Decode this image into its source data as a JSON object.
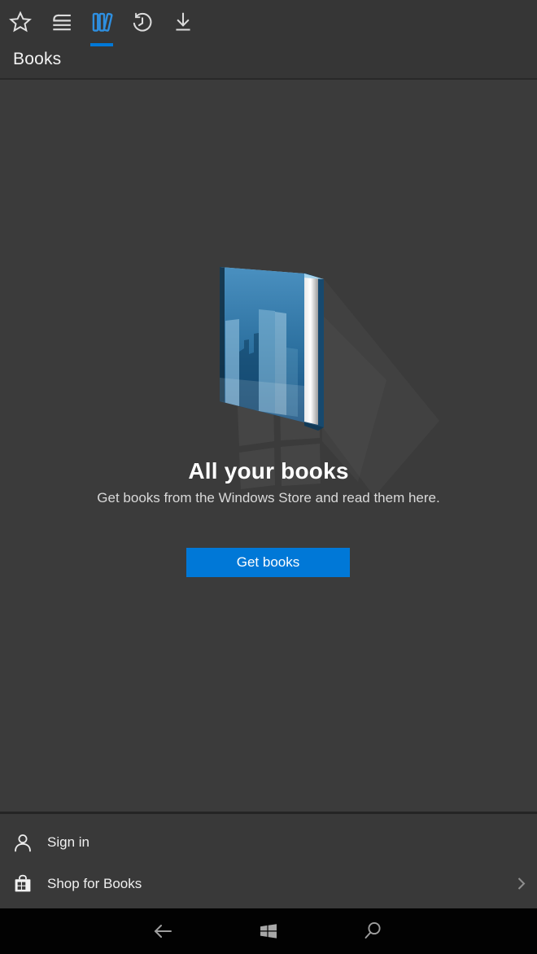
{
  "header": {
    "title": "Books",
    "tabs": [
      {
        "name": "favorites",
        "icon": "star-icon",
        "active": false
      },
      {
        "name": "reading-list",
        "icon": "reading-list-icon",
        "active": false
      },
      {
        "name": "books",
        "icon": "books-icon",
        "active": true
      },
      {
        "name": "history",
        "icon": "history-icon",
        "active": false
      },
      {
        "name": "downloads",
        "icon": "download-icon",
        "active": false
      }
    ]
  },
  "main": {
    "heading": "All your books",
    "subtitle": "Get books from the Windows Store and read them here.",
    "button_label": "Get books",
    "illustration": "blue-book-with-city-skyline-cover-over-faint-windows-logo-watermark"
  },
  "menu": {
    "items": [
      {
        "label": "Sign in",
        "icon": "person-icon",
        "chevron": false
      },
      {
        "label": "Shop for Books",
        "icon": "store-icon",
        "chevron": true
      }
    ]
  },
  "navbar": {
    "icons": [
      "back-icon",
      "windows-logo-icon",
      "search-icon"
    ]
  },
  "colors": {
    "accent_blue": "#0078d7",
    "tab_icon_blue": "#2e8fe0",
    "top_bar_bg": "#363636",
    "main_bg": "#3b3b3b",
    "bottom_menu_bg": "#393939",
    "nav_bar_bg": "#020202",
    "icon_gray": "#dcdcdc",
    "nav_icon_gray": "#a0a0a0",
    "book_cover_top": "#4a90c0",
    "book_cover_bottom": "#175180"
  }
}
